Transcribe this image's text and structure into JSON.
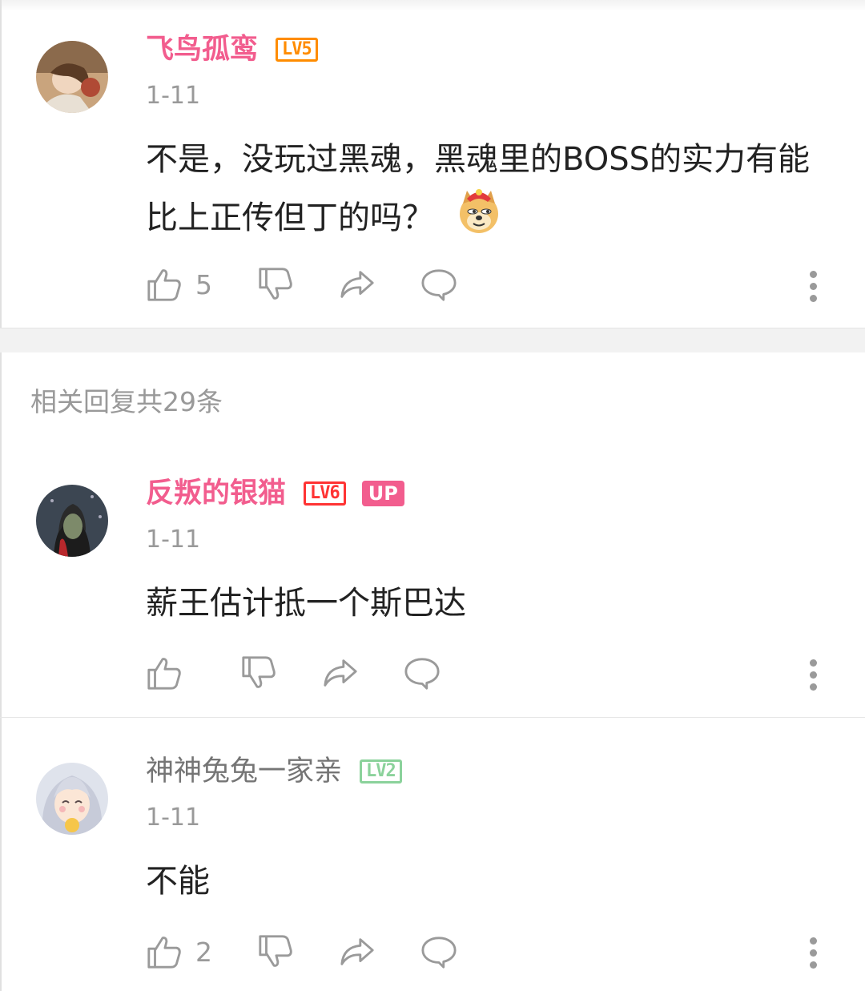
{
  "colors": {
    "vip_pink": "#f25d8e",
    "normal_name": "#757575",
    "lv5": "#ff8c00",
    "lv6": "#ff3333",
    "lv2": "#8bd29b",
    "up_badge": "#f25d8e"
  },
  "main_comment": {
    "username": "飞鸟孤鸾",
    "level": "LV5",
    "date": "1-11",
    "text": "不是，没玩过黑魂，黑魂里的BOSS的实力有能比上正传但丁的吗？",
    "emoji": "doge-emoji",
    "likes": "5"
  },
  "section_header": "相关回复共29条",
  "replies": [
    {
      "username": "反叛的银猫",
      "level": "LV6",
      "badge": "UP",
      "date": "1-11",
      "text": "薪王估计抵一个斯巴达",
      "likes": ""
    },
    {
      "username": "神神兔兔一家亲",
      "level": "LV2",
      "date": "1-11",
      "text": "不能",
      "likes": "2"
    }
  ],
  "icons": {
    "like": "thumbs-up-icon",
    "dislike": "thumbs-down-icon",
    "share": "share-icon",
    "reply": "comment-icon",
    "more": "more-vertical-icon"
  }
}
